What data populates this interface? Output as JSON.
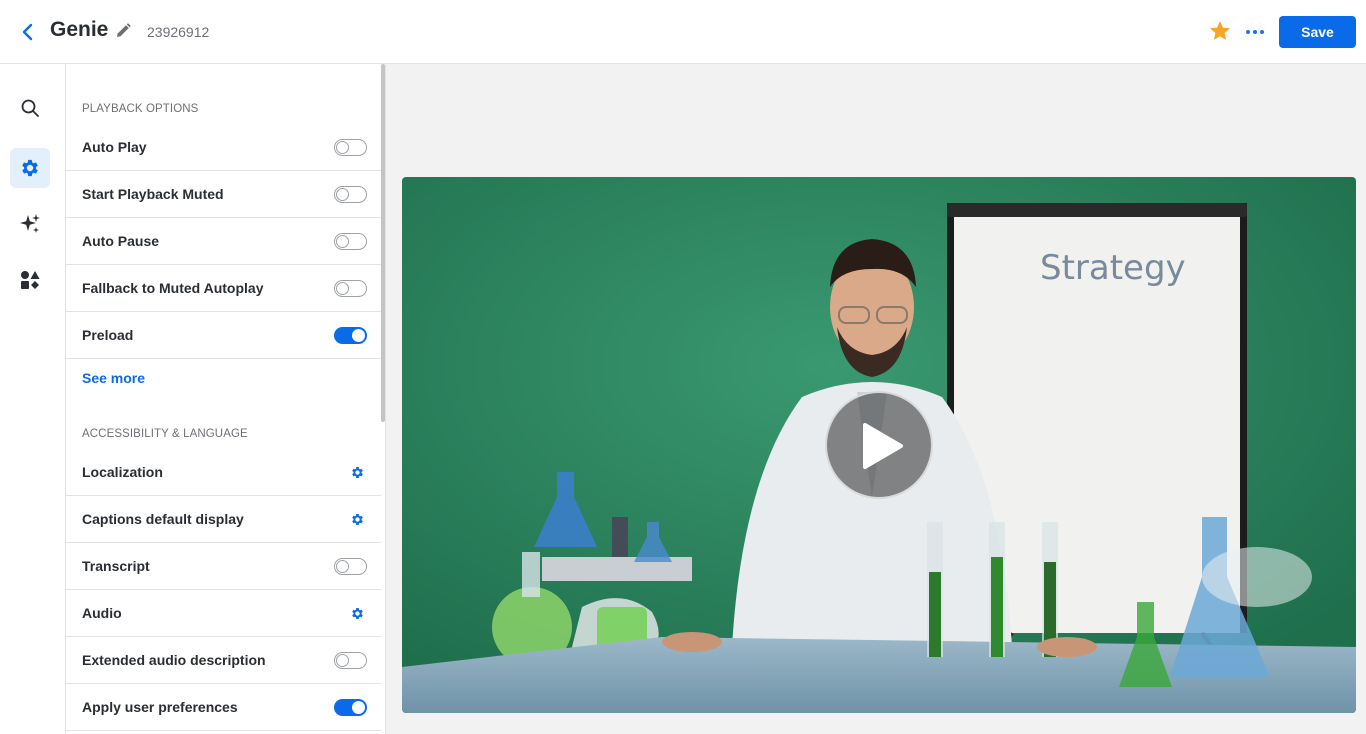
{
  "header": {
    "title": "Genie",
    "player_id": "23926912",
    "save_label": "Save"
  },
  "rail": {
    "items": [
      "search-icon",
      "settings-gear-icon",
      "sparkles-icon",
      "shapes-icon"
    ],
    "active": "settings-gear-icon"
  },
  "playback": {
    "section_title": "PLAYBACK OPTIONS",
    "items": [
      {
        "label": "Auto Play",
        "control": "toggle",
        "on": false
      },
      {
        "label": "Start Playback Muted",
        "control": "toggle",
        "on": false
      },
      {
        "label": "Auto Pause",
        "control": "toggle",
        "on": false
      },
      {
        "label": "Fallback to Muted Autoplay",
        "control": "toggle",
        "on": false
      },
      {
        "label": "Preload",
        "control": "toggle",
        "on": true
      }
    ],
    "see_more": "See more"
  },
  "accessibility": {
    "section_title": "ACCESSIBILITY & LANGUAGE",
    "items": [
      {
        "label": "Localization",
        "control": "gear"
      },
      {
        "label": "Captions default display",
        "control": "gear"
      },
      {
        "label": "Transcript",
        "control": "toggle",
        "on": false
      },
      {
        "label": "Audio",
        "control": "gear"
      },
      {
        "label": "Extended audio description",
        "control": "toggle",
        "on": false
      },
      {
        "label": "Apply user preferences",
        "control": "toggle",
        "on": true
      }
    ]
  },
  "video": {
    "whiteboard_text": "Strategy"
  },
  "colors": {
    "accent": "#0a6bea",
    "star": "#f5a623",
    "greenscreen": "#2e8a63"
  }
}
